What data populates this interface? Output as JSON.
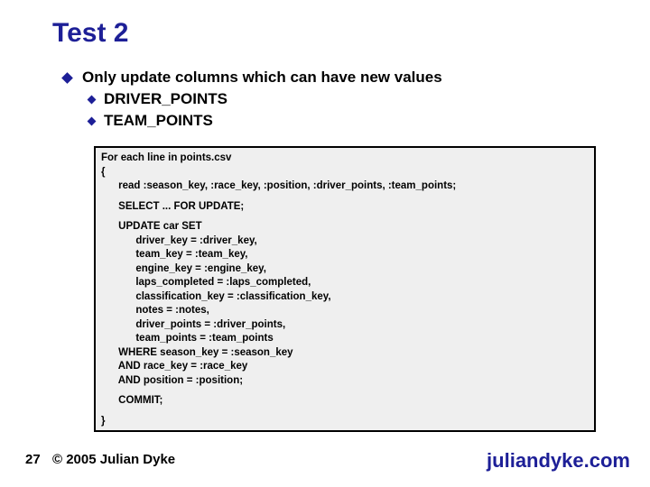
{
  "slide": {
    "title": "Test 2",
    "page_number": "27",
    "copyright": "© 2005 Julian Dyke",
    "website": "juliandyke.com",
    "bullet_main": "Only update columns which can have new values",
    "sub_bullets": [
      "DRIVER_POINTS",
      "TEAM_POINTS"
    ],
    "code": {
      "l01": "For each line in points.csv",
      "l02": "{",
      "l03": "      read :season_key, :race_key, :position, :driver_points, :team_points;",
      "l04": "      SELECT ... FOR UPDATE;",
      "l05": "      UPDATE car SET",
      "l06": "            driver_key = :driver_key,",
      "l07": "            team_key = :team_key,",
      "l08": "            engine_key = :engine_key,",
      "l09": "            laps_completed = :laps_completed,",
      "l10": "            classification_key = :classification_key,",
      "l11": "            notes = :notes,",
      "l12": "            driver_points = :driver_points,",
      "l13": "            team_points = :team_points",
      "l14": "      WHERE season_key = :season_key",
      "l15": "      AND race_key = :race_key",
      "l16": "      AND position = :position;",
      "l17": "      COMMIT;",
      "l18": "}"
    }
  }
}
